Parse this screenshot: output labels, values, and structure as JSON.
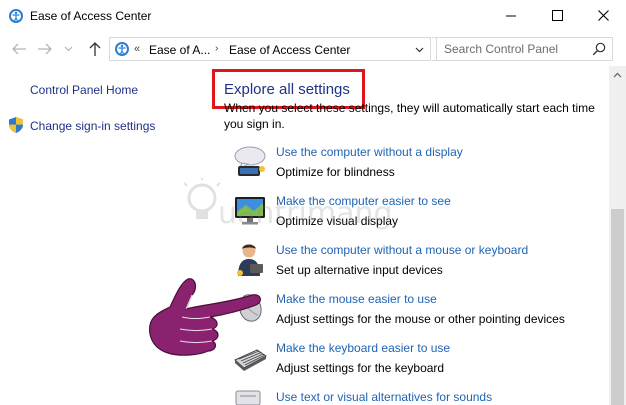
{
  "window": {
    "title": "Ease of Access Center",
    "minimize_icon": "minimize-icon",
    "maximize_icon": "maximize-icon",
    "close_icon": "close-icon"
  },
  "address_bar": {
    "overflow_chevron": "«",
    "breadcrumbs": [
      "Ease of A...",
      "Ease of Access Center"
    ],
    "separator": "›"
  },
  "search": {
    "placeholder": "Search Control Panel"
  },
  "sidebar": {
    "items": [
      {
        "label": "Control Panel Home"
      },
      {
        "label": "Change sign-in settings",
        "icon": "shield-icon"
      }
    ]
  },
  "main": {
    "heading": "Explore all settings",
    "description": "When you select these settings, they will automatically start each time you sign in.",
    "items": [
      {
        "link": "Use the computer without a display",
        "desc": "Optimize for blindness",
        "icon": "display-speech-icon"
      },
      {
        "link": "Make the computer easier to see",
        "desc": "Optimize visual display",
        "icon": "monitor-icon"
      },
      {
        "link": "Use the computer without a mouse or keyboard",
        "desc": "Set up alternative input devices",
        "icon": "person-icon"
      },
      {
        "link": "Make the mouse easier to use",
        "desc": "Adjust settings for the mouse or other pointing devices",
        "icon": "mouse-icon"
      },
      {
        "link": "Make the keyboard easier to use",
        "desc": "Adjust settings for the keyboard",
        "icon": "keyboard-icon"
      },
      {
        "link": "Use text or visual alternatives for sounds",
        "desc": "",
        "icon": "sound-text-icon"
      }
    ]
  },
  "watermark": {
    "text": "uantrimang"
  },
  "colors": {
    "link": "#1e64b4",
    "heading": "#1e3287",
    "highlight": "#e0151b"
  }
}
